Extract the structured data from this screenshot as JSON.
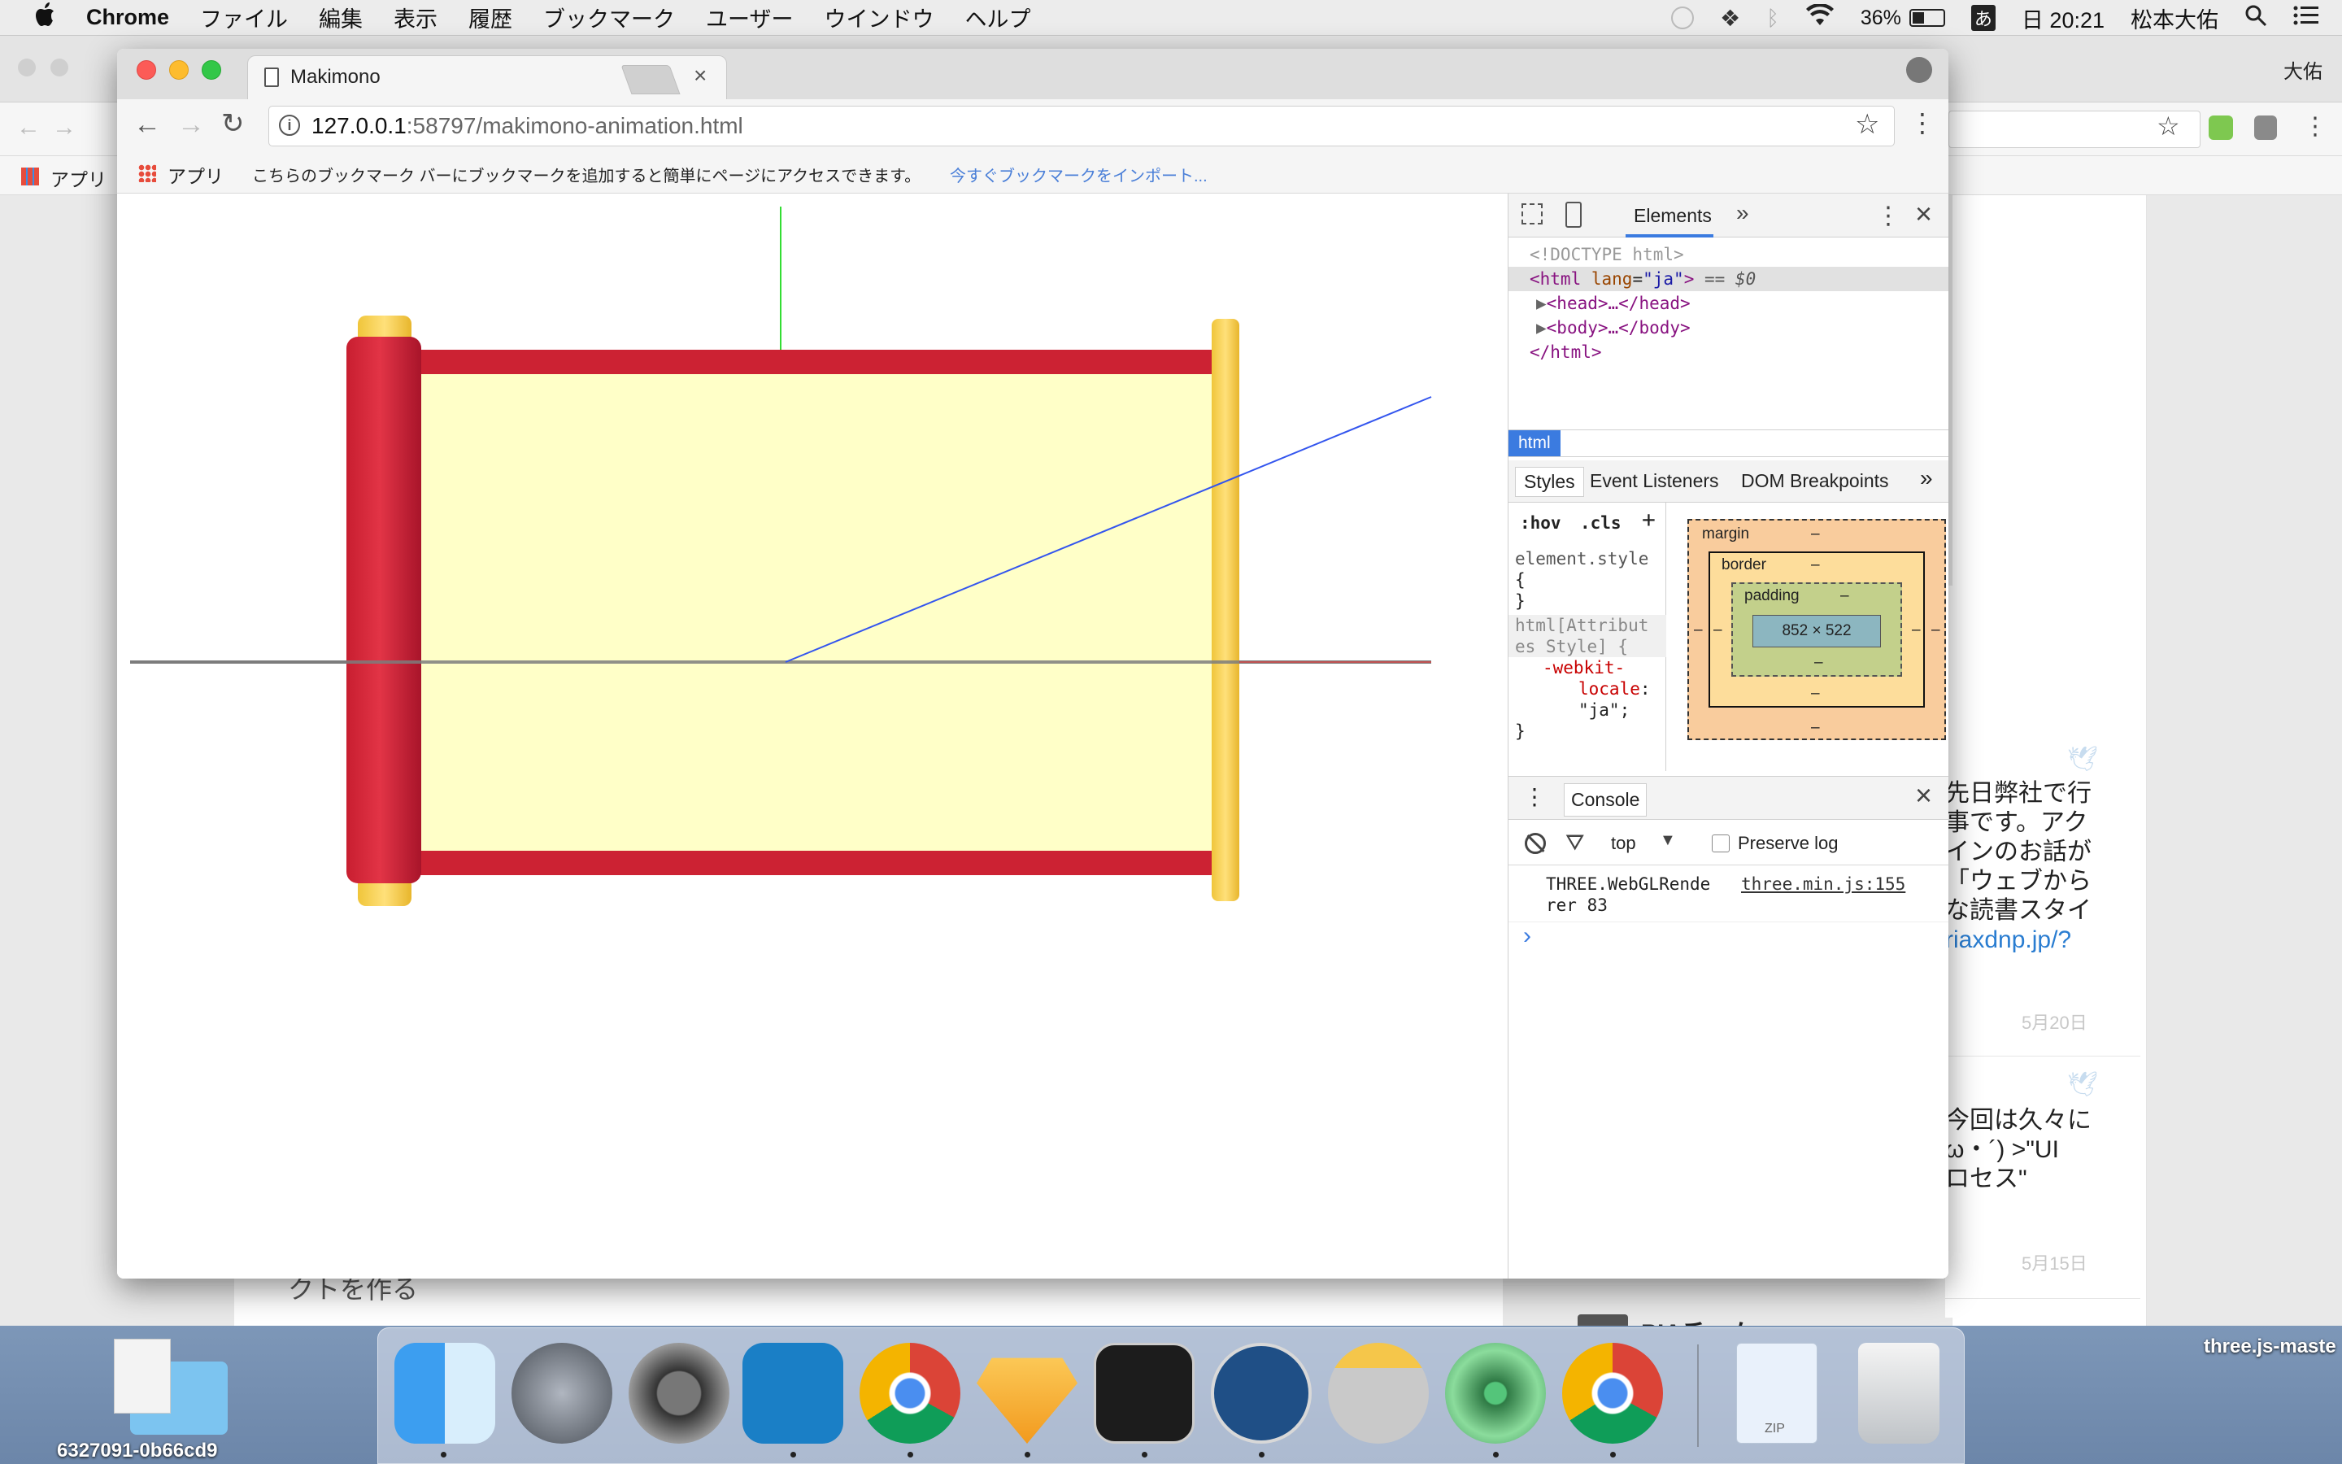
{
  "menubar": {
    "apple": "",
    "app": "Chrome",
    "items": [
      "ファイル",
      "編集",
      "表示",
      "履歴",
      "ブックマーク",
      "ユーザー",
      "ウインドウ",
      "ヘルプ"
    ],
    "battery": "36%",
    "input_method": "あ",
    "clock": "日 20:21",
    "user": "松本大佑"
  },
  "background_window": {
    "profile_name": "大佑",
    "bookmark_apps": "アプリ",
    "left_card_text": "クトを作る",
    "tweets": [
      {
        "lines": [
          "先日弊社で行",
          "事です。アク",
          "インのお話が",
          "「ウェブから",
          "な読書スタイ"
        ],
        "link": "riaxdnp.jp/?",
        "date": "5月20日"
      },
      {
        "lines": [
          "今回は久々に",
          "ω・´) >\"UI",
          "ロセス\""
        ],
        "date": "5月15日"
      }
    ],
    "bottom_author": "PIAチーム"
  },
  "browser": {
    "tab_title": "Makimono",
    "url_host": "127.0.0.1",
    "url_rest": ":58797/makimono-animation.html",
    "bookmarks": {
      "apps_label": "アプリ",
      "hint": "こちらのブックマーク バーにブックマークを追加すると簡単にページにアクセスできます。",
      "import_link": "今すぐブックマークをインポート..."
    }
  },
  "scene": {
    "colors": {
      "scroll_paper": "#ffffc8",
      "scroll_border": "#cc2233",
      "left_roll": "#cc2233",
      "rod_caps": "#f5d45a",
      "axis_y": "#33dd33",
      "axis_z": "#3355ee",
      "axis_x": "#777777"
    }
  },
  "devtools": {
    "tabs": {
      "elements": "Elements",
      "more": "»"
    },
    "dom": {
      "doctype": "<!DOCTYPE html>",
      "html_open_tag": "<html",
      "html_attr_name": "lang",
      "html_attr_value": "\"ja\"",
      "html_close_bracket": ">",
      "html_eq": "== $0",
      "head": "<head>…</head>",
      "body": "<body>…</body>",
      "html_close": "</html>"
    },
    "breadcrumb": "html",
    "subtabs": [
      "Styles",
      "Event Listeners",
      "DOM Breakpoints",
      "»"
    ],
    "styles": {
      "hov": ":hov",
      "cls": ".cls",
      "plus": "+",
      "element_style": "element.style",
      "open_brace": "{",
      "close_brace": "}",
      "rule_selector_1": "html[Attribut",
      "rule_selector_2": "es Style] {",
      "prop_1": "-webkit-",
      "prop_2": "locale",
      "colon": ":",
      "value": "\"ja\";",
      "rule_close": "}"
    },
    "boxmodel": {
      "margin": "margin",
      "border": "border",
      "padding": "padding",
      "dash": "–",
      "content": "852 × 522"
    },
    "console": {
      "tab": "Console",
      "context": "top",
      "preserve_log": "Preserve log",
      "message_1": "THREE.WebGLRende",
      "message_2": "rer 83",
      "source": "three.min.js:155",
      "prompt": "›"
    }
  },
  "dock": {
    "left_file": "6327091-0b66cd9",
    "right_file": "three.js-maste",
    "zip_label": "ZIP"
  }
}
